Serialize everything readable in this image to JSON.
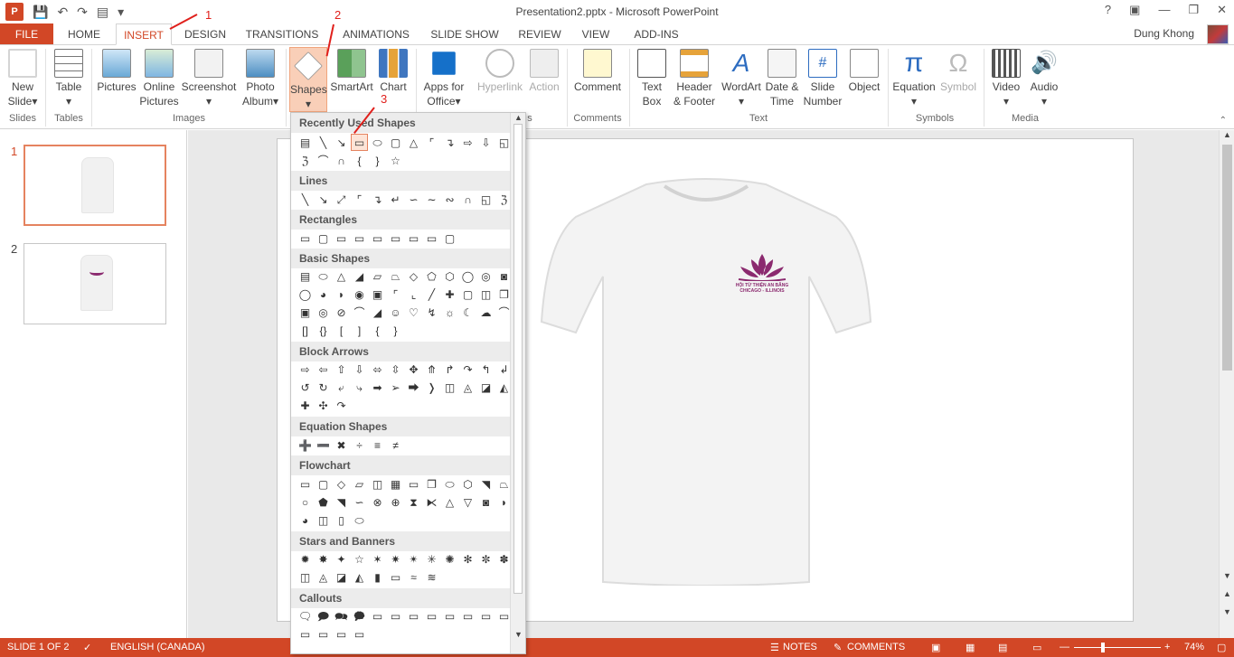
{
  "window": {
    "title": "Presentation2.pptx - Microsoft PowerPoint"
  },
  "qat": {
    "icons": [
      "powerpoint-icon",
      "save-icon",
      "undo-icon",
      "redo-icon",
      "start-from-beginning-icon"
    ]
  },
  "tabs": {
    "file": "FILE",
    "home": "HOME",
    "insert": "INSERT",
    "design": "DESIGN",
    "transitions": "TRANSITIONS",
    "animations": "ANIMATIONS",
    "slideshow": "SLIDE SHOW",
    "review": "REVIEW",
    "view": "VIEW",
    "addins": "ADD-INS"
  },
  "user": {
    "name": "Dung Khong"
  },
  "ribbon": {
    "new_slide": [
      "New",
      "Slide"
    ],
    "table": "Table",
    "pictures": "Pictures",
    "online_pictures": [
      "Online",
      "Pictures"
    ],
    "screenshot": "Screenshot",
    "photo_album": [
      "Photo",
      "Album"
    ],
    "shapes": "Shapes",
    "smartart": "SmartArt",
    "chart": "Chart",
    "apps": [
      "Apps for",
      "Office"
    ],
    "hyperlink": "Hyperlink",
    "action": "Action",
    "comment": "Comment",
    "text_box": [
      "Text",
      "Box"
    ],
    "header_footer": [
      "Header",
      "& Footer"
    ],
    "wordart": "WordArt",
    "date_time": [
      "Date &",
      "Time"
    ],
    "slide_number": [
      "Slide",
      "Number"
    ],
    "object": "Object",
    "equation": "Equation",
    "symbol": "Symbol",
    "video": "Video",
    "audio": "Audio",
    "groups": {
      "slides": "Slides",
      "tables": "Tables",
      "images": "Images",
      "links": "s",
      "comments": "Comments",
      "text": "Text",
      "symbols": "Symbols",
      "media": "Media"
    }
  },
  "shapes_menu": {
    "sections": [
      "Recently Used Shapes",
      "Lines",
      "Rectangles",
      "Basic Shapes",
      "Block Arrows",
      "Equation Shapes",
      "Flowchart",
      "Stars and Banners",
      "Callouts"
    ]
  },
  "thumbnails": {
    "nums": [
      "1",
      "2"
    ]
  },
  "logo": {
    "line1": "HỘI TỪ THIỆN AN BĂNG",
    "line2": "CHICAGO - ILLINOIS"
  },
  "annotations": {
    "one": "1",
    "two": "2",
    "three": "3"
  },
  "status": {
    "slide": "SLIDE 1 OF 2",
    "language": "ENGLISH (CANADA)",
    "notes": "NOTES",
    "comments": "COMMENTS",
    "zoom": "74%"
  }
}
